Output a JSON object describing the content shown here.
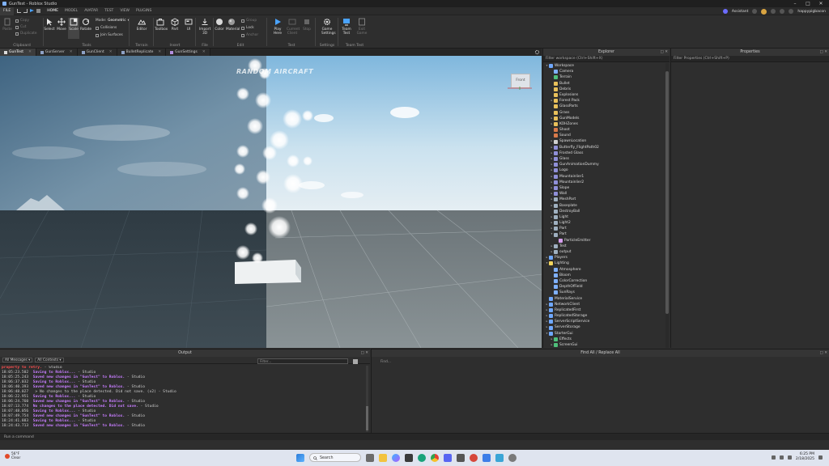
{
  "window": {
    "title": "GunTest - Roblox Studio"
  },
  "menu": {
    "file": "FILE",
    "tabs": [
      "HOME",
      "MODEL",
      "AVATAR",
      "TEST",
      "VIEW",
      "PLUGINS"
    ],
    "assistant": "Assistant",
    "username": "happypigbacon"
  },
  "ribbon": {
    "clipboard": {
      "label": "Clipboard",
      "paste": "Paste",
      "copy": "Copy",
      "cut": "Cut",
      "duplicate": "Duplicate"
    },
    "tools": {
      "label": "Tools",
      "select": "Select",
      "move": "Move",
      "scale": "Scale",
      "rotate": "Rotate",
      "mode": "Mode:",
      "mode_value": "Geometric",
      "collisions": "Collisions",
      "join_surfaces": "Join Surfaces"
    },
    "terrain": {
      "label": "Terrain",
      "editor": "Editor"
    },
    "insert": {
      "label": "Insert",
      "toolbox": "Toolbox",
      "part": "Part",
      "ui": "UI"
    },
    "file": {
      "label": "File",
      "import3d": "Import\n3D"
    },
    "edit": {
      "label": "Edit",
      "color": "Color",
      "material": "Material",
      "group": "Group",
      "lock": "Lock",
      "anchor": "Anchor"
    },
    "test": {
      "label": "Test",
      "play_here": "Play\nHere",
      "current_client": "Current\nClient",
      "stop": "Stop"
    },
    "settings": {
      "label": "Settings",
      "game_settings": "Game\nSettings"
    },
    "team_test": {
      "label": "Team Test",
      "team_test": "Team\nTest",
      "exit_game": "Exit\nGame"
    }
  },
  "doc_tabs": [
    "GunTest",
    "GunServer",
    "GunClient",
    "BulletReplicate",
    "GunSettings"
  ],
  "viewport": {
    "title": "RANDOM AIRCRAFT",
    "viewcube": "Front"
  },
  "explorer": {
    "title": "Explorer",
    "filter": "Filter workspace (Ctrl+Shift+X)",
    "items": [
      {
        "label": "Workspace",
        "indent": 0,
        "arrow": "▾",
        "color": "#6fa8ff"
      },
      {
        "label": "Camera",
        "indent": 1,
        "arrow": "",
        "color": "#7fb0ff"
      },
      {
        "label": "Terrain",
        "indent": 1,
        "arrow": "",
        "color": "#4fbf7a"
      },
      {
        "label": "Bullet",
        "indent": 1,
        "arrow": "",
        "color": "#e8c05a"
      },
      {
        "label": "Debris",
        "indent": 1,
        "arrow": "",
        "color": "#e8c05a"
      },
      {
        "label": "Explosions",
        "indent": 1,
        "arrow": "",
        "color": "#e8c05a"
      },
      {
        "label": "Forest Pack",
        "indent": 1,
        "arrow": "▸",
        "color": "#e8c05a"
      },
      {
        "label": "GlassParts",
        "indent": 1,
        "arrow": "",
        "color": "#e8c05a"
      },
      {
        "label": "Grass",
        "indent": 1,
        "arrow": "",
        "color": "#e8c05a"
      },
      {
        "label": "GunModels",
        "indent": 1,
        "arrow": "▸",
        "color": "#e8c05a"
      },
      {
        "label": "KOHZones",
        "indent": 1,
        "arrow": "▸",
        "color": "#e8c05a"
      },
      {
        "label": "Shoot",
        "indent": 1,
        "arrow": "",
        "color": "#d87a4a"
      },
      {
        "label": "Sound",
        "indent": 1,
        "arrow": "",
        "color": "#d87a4a"
      },
      {
        "label": "SpawnLocation",
        "indent": 1,
        "arrow": "▸",
        "color": "#cfcfcf"
      },
      {
        "label": "Butterfly_FlightPath02",
        "indent": 1,
        "arrow": "▸",
        "color": "#8f8fd8"
      },
      {
        "label": "Frosted Glass",
        "indent": 1,
        "arrow": "▸",
        "color": "#8f8fd8"
      },
      {
        "label": "Glass",
        "indent": 1,
        "arrow": "▸",
        "color": "#8f8fd8"
      },
      {
        "label": "GunAnimationDummy",
        "indent": 1,
        "arrow": "▸",
        "color": "#8f8fd8"
      },
      {
        "label": "Logo",
        "indent": 1,
        "arrow": "▸",
        "color": "#8f8fd8"
      },
      {
        "label": "Mountainlier1",
        "indent": 1,
        "arrow": "▸",
        "color": "#8f8fd8"
      },
      {
        "label": "Mountainlier2",
        "indent": 1,
        "arrow": "▸",
        "color": "#8f8fd8"
      },
      {
        "label": "Slope",
        "indent": 1,
        "arrow": "▸",
        "color": "#8f8fd8"
      },
      {
        "label": "Wall",
        "indent": 1,
        "arrow": "▸",
        "color": "#8f8fd8"
      },
      {
        "label": "MeshPart",
        "indent": 1,
        "arrow": "▸",
        "color": "#9fb0c0"
      },
      {
        "label": "Baseplate",
        "indent": 1,
        "arrow": "▸",
        "color": "#9fb0c0"
      },
      {
        "label": "DestroyBall",
        "indent": 1,
        "arrow": "",
        "color": "#9fb0c0"
      },
      {
        "label": "Light",
        "indent": 1,
        "arrow": "▸",
        "color": "#9fb0c0"
      },
      {
        "label": "Light2",
        "indent": 1,
        "arrow": "▸",
        "color": "#9fb0c0"
      },
      {
        "label": "Part",
        "indent": 1,
        "arrow": "▸",
        "color": "#9fb0c0"
      },
      {
        "label": "Part",
        "indent": 1,
        "arrow": "▾",
        "color": "#9fb0c0"
      },
      {
        "label": "ParticleEmitter",
        "indent": 2,
        "arrow": "",
        "color": "#d8a0f0"
      },
      {
        "label": "Test",
        "indent": 1,
        "arrow": "▸",
        "color": "#9fb0c0"
      },
      {
        "label": "output",
        "indent": 1,
        "arrow": "▸",
        "color": "#9fb0c0"
      },
      {
        "label": "Players",
        "indent": 0,
        "arrow": "▸",
        "color": "#6fa8ff"
      },
      {
        "label": "Lighting",
        "indent": 0,
        "arrow": "▾",
        "color": "#f2d45c"
      },
      {
        "label": "Atmosphere",
        "indent": 1,
        "arrow": "",
        "color": "#7fb0ff"
      },
      {
        "label": "Bloom",
        "indent": 1,
        "arrow": "",
        "color": "#7fb0ff"
      },
      {
        "label": "ColorCorrection",
        "indent": 1,
        "arrow": "",
        "color": "#7fb0ff"
      },
      {
        "label": "DepthOfField",
        "indent": 1,
        "arrow": "",
        "color": "#7fb0ff"
      },
      {
        "label": "SunRays",
        "indent": 1,
        "arrow": "",
        "color": "#7fb0ff"
      },
      {
        "label": "MaterialService",
        "indent": 0,
        "arrow": "",
        "color": "#6fa8ff"
      },
      {
        "label": "NetworkClient",
        "indent": 0,
        "arrow": "▸",
        "color": "#6fa8ff"
      },
      {
        "label": "ReplicatedFirst",
        "indent": 0,
        "arrow": "▸",
        "color": "#6fa8ff"
      },
      {
        "label": "ReplicatedStorage",
        "indent": 0,
        "arrow": "▸",
        "color": "#6fa8ff"
      },
      {
        "label": "ServerScriptService",
        "indent": 0,
        "arrow": "▸",
        "color": "#6fa8ff"
      },
      {
        "label": "ServerStorage",
        "indent": 0,
        "arrow": "▸",
        "color": "#6fa8ff"
      },
      {
        "label": "StarterGui",
        "indent": 0,
        "arrow": "▾",
        "color": "#6fa8ff"
      },
      {
        "label": "Effects",
        "indent": 1,
        "arrow": "▸",
        "color": "#4fbf7a"
      },
      {
        "label": "ScreenGui",
        "indent": 1,
        "arrow": "▸",
        "color": "#4fbf7a"
      }
    ]
  },
  "properties": {
    "title": "Properties",
    "filter": "Filter Properties (Ctrl+Shift+P)"
  },
  "output": {
    "title": "Output",
    "messages_dropdown": "All Messages",
    "contexts_dropdown": "All Contexts",
    "filter_placeholder": "Filter...",
    "lines": [
      {
        "ts": "",
        "msg": "property to retry.",
        "kind": "red",
        "src": " - Studio"
      },
      {
        "ts": "18:05:23.502",
        "msg": "Saving to Roblox...",
        "kind": "purple",
        "src": " - Studio"
      },
      {
        "ts": "18:05:25.243",
        "msg": "Saved new changes in \"GunTest\" to Roblox.",
        "kind": "purple",
        "src": " - Studio"
      },
      {
        "ts": "18:06:37.032",
        "msg": "Saving to Roblox...",
        "kind": "purple",
        "src": " - Studio"
      },
      {
        "ts": "18:06:40.393",
        "msg": "Saved new changes in \"GunTest\" to Roblox.",
        "kind": "purple",
        "src": " - Studio"
      },
      {
        "ts": "18:06:48.027",
        "msg": " > No changes to the place detected. Did not save. (x2)",
        "kind": "white",
        "src": " - Studio"
      },
      {
        "ts": "18:06:22.951",
        "msg": "Saving to Roblox...",
        "kind": "purple",
        "src": " - Studio"
      },
      {
        "ts": "18:06:24.760",
        "msg": "Saved new changes in \"GunTest\" to Roblox.",
        "kind": "purple",
        "src": " - Studio"
      },
      {
        "ts": "18:07:13.774",
        "msg": "No changes to the place detected. Did not save.",
        "kind": "purple",
        "src": " - Studio"
      },
      {
        "ts": "18:07:48.056",
        "msg": "Saving to Roblox...",
        "kind": "purple",
        "src": " - Studio"
      },
      {
        "ts": "18:07:49.754",
        "msg": "Saved new changes in \"GunTest\" to Roblox.",
        "kind": "purple",
        "src": " - Studio"
      },
      {
        "ts": "18:24:41.883",
        "msg": "Saving to Roblox...",
        "kind": "purple",
        "src": " - Studio"
      },
      {
        "ts": "18:24:43.713",
        "msg": "Saved new changes in \"GunTest\" to Roblox.",
        "kind": "purple",
        "src": " - Studio"
      }
    ]
  },
  "findall": {
    "title": "Find All / Replace All",
    "placeholder": "Find..."
  },
  "command": {
    "placeholder": "Run a command"
  },
  "taskbar": {
    "weather_temp": "56°F",
    "weather_desc": "Clear",
    "search": "Search",
    "time": "6:25 PM",
    "date": "2/18/2025"
  }
}
